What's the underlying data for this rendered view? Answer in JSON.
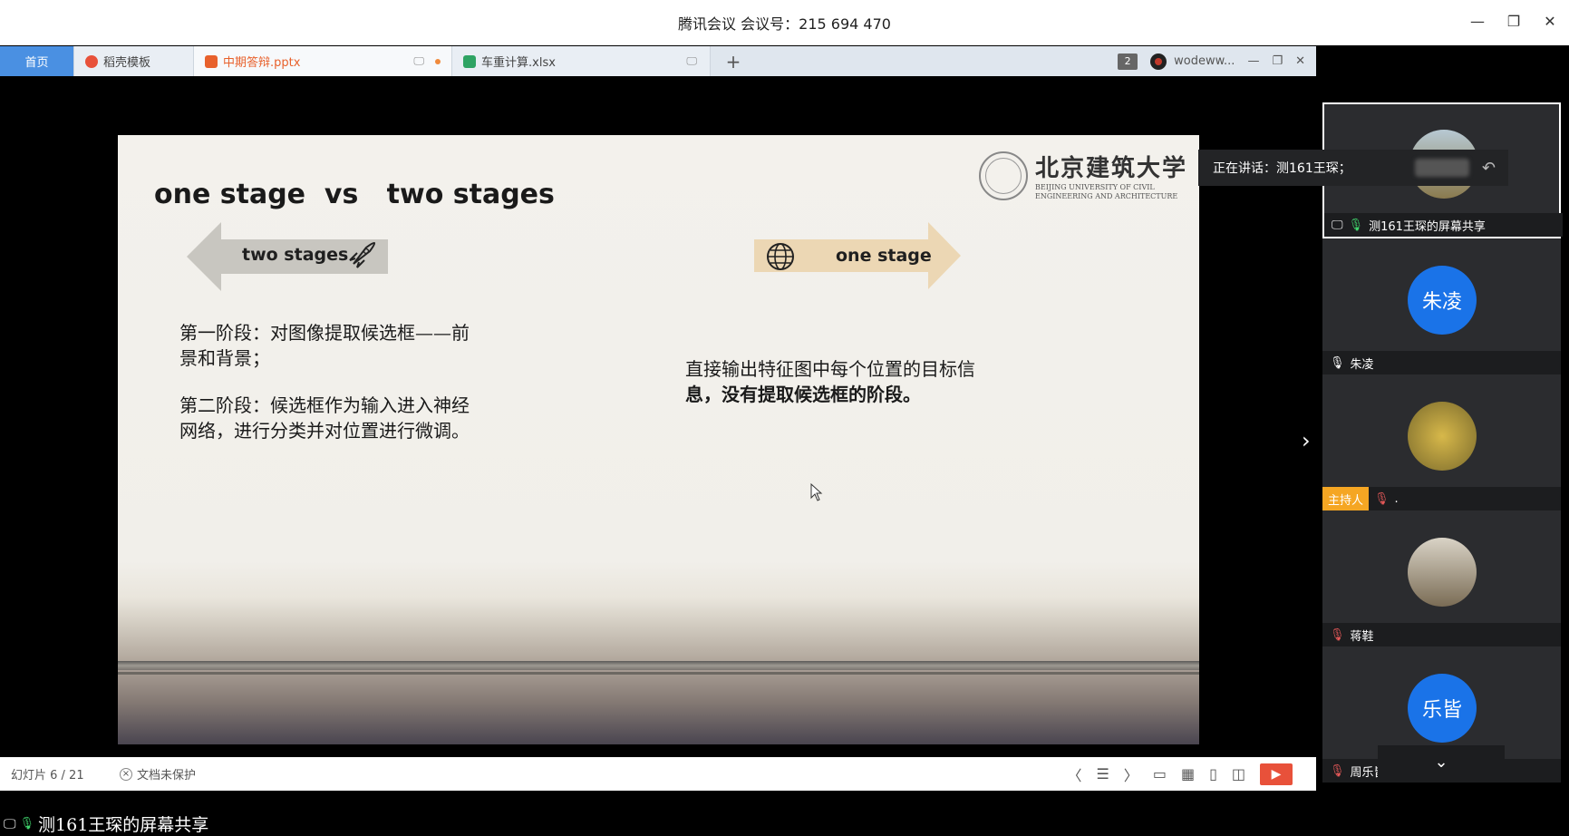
{
  "window": {
    "title": "腾讯会议 会议号：215 694 470",
    "minimize": "—",
    "restore": "❐",
    "close": "✕"
  },
  "tabbar": {
    "home": "首页",
    "tabs": [
      {
        "label": "稻壳模板",
        "color": "#e8513a"
      },
      {
        "label": "中期答辩.pptx",
        "color": "#e8612c"
      },
      {
        "label": "车重计算.xlsx",
        "color": "#2ea363"
      }
    ],
    "add": "+",
    "badge": "2",
    "user": "wodeww...",
    "min": "—",
    "restore": "❐",
    "close": "✕"
  },
  "slide": {
    "title": "one stage  vs   two stages",
    "logo_cn": "北京建筑大学",
    "logo_en_1": "BEIJING UNIVERSITY OF CIVIL",
    "logo_en_2": "ENGINEERING AND ARCHITECTURE",
    "left_arrow_label": "two stages",
    "right_arrow_label": "one stage",
    "left_para_1a": "第一阶段：对图像提取候选框——前",
    "left_para_1b": "景和背景；",
    "left_para_2a": "第二阶段：候选框作为输入进入神经",
    "left_para_2b": "网络，进行分类并对位置进行微调。",
    "right_para_a": "直接输出特征图中每个位置的目标信",
    "right_para_b": "息，没有提取候选框的阶段。"
  },
  "statusbar": {
    "slide_no": "幻灯片 6 / 21",
    "protect": "文档未保护",
    "prev": "〈",
    "list": "☰",
    "next": "〉"
  },
  "share_label": "测161王琛的屏幕共享",
  "speaking": "正在讲话：测161王琛；",
  "participants": [
    {
      "name": "测161王琛的屏幕共享",
      "mic": "on",
      "avatar": "",
      "color": "#8aa6b5"
    },
    {
      "name": "朱凌",
      "mic": "on",
      "avatar": "朱凌",
      "color": "#1a73e8"
    },
    {
      "name": ".",
      "mic": "off",
      "host": "主持人",
      "avatar": "",
      "color": "#b5a23c"
    },
    {
      "name": "蒋鞋",
      "mic": "off",
      "avatar": "",
      "color": "#8a7a66"
    },
    {
      "name": "周乐皆",
      "mic": "off",
      "avatar": "乐皆",
      "color": "#1a73e8"
    }
  ],
  "colors": {
    "accent": "#4a90e2",
    "play": "#e8513a",
    "host": "#f5a623"
  }
}
